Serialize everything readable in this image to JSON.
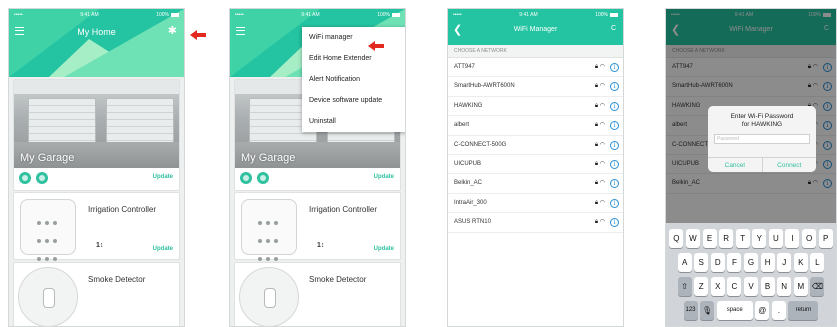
{
  "status": {
    "carrier": "••••• ",
    "time": "9:41 AM",
    "battery": "100%"
  },
  "home": {
    "title": "My Home",
    "garage": {
      "label": "My Garage",
      "update": "Update"
    },
    "irrigation": {
      "title": "Irrigation Controller",
      "update": "Update",
      "valve": "1↕"
    },
    "smoke": {
      "title": "Smoke Detector"
    }
  },
  "menu": {
    "items": [
      "WiFi manager",
      "Edit Home Extender",
      "Alert Notification",
      "Device software update",
      "Uninstall"
    ]
  },
  "wifi": {
    "title": "WiFi Manager",
    "refresh": "C",
    "section": "CHOOSE A NETWORK",
    "networks": [
      "ATT947",
      "SmartHub-AWRT600N",
      "HAWKING",
      "albert",
      "C-CONNECT-500G",
      "UICUPUB",
      "Belkin_AC",
      "IntraAir_300",
      "ASUS RTN10"
    ]
  },
  "dialog": {
    "title_line1": "Enter Wi-Fi Password",
    "title_line2": "for HAWKING",
    "placeholder": "Password",
    "cancel": "Cancel",
    "connect": "Connect"
  },
  "keyboard": {
    "row1": [
      "Q",
      "W",
      "E",
      "R",
      "T",
      "Y",
      "U",
      "I",
      "O",
      "P"
    ],
    "row2": [
      "A",
      "S",
      "D",
      "F",
      "G",
      "H",
      "J",
      "K",
      "L"
    ],
    "row3": [
      "Z",
      "X",
      "C",
      "V",
      "B",
      "N",
      "M"
    ],
    "numbers": "123",
    "space": "space",
    "at": "@",
    "dot": ".",
    "return": "return"
  },
  "colors": {
    "accent": "#24c3a1",
    "arrow": "#e3281f",
    "info": "#2b8fd8"
  }
}
